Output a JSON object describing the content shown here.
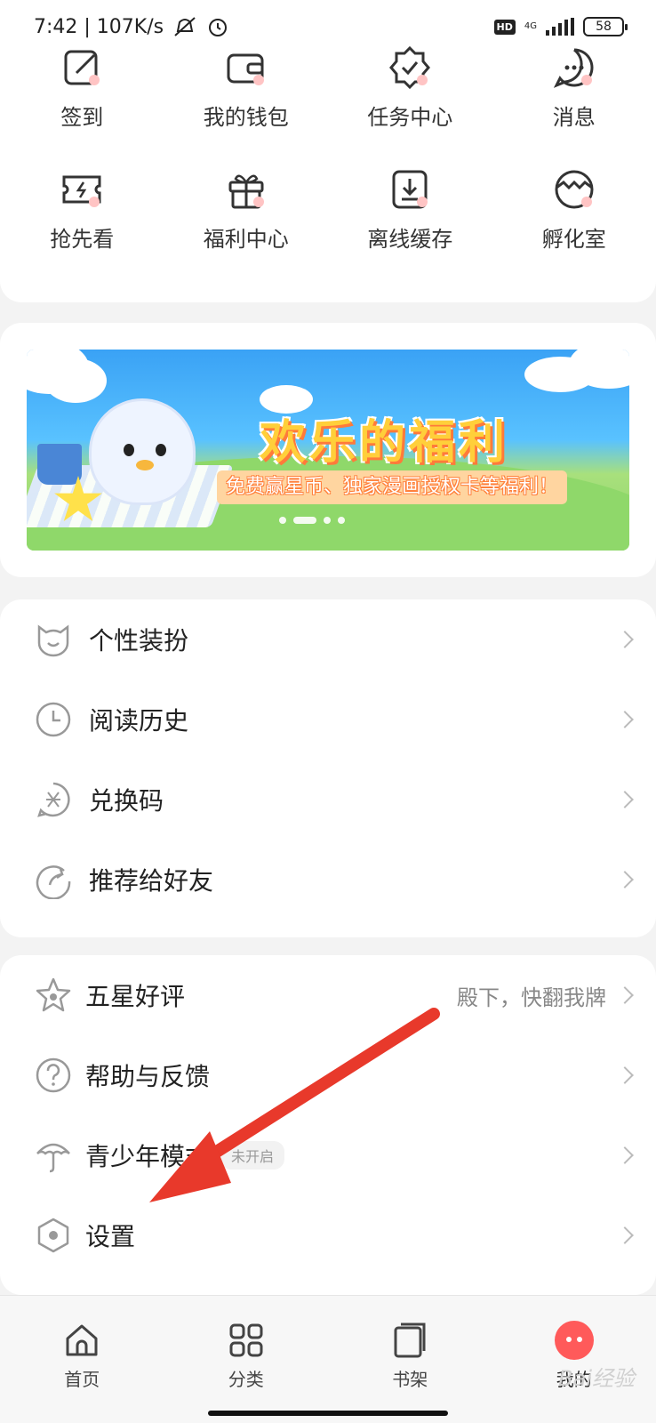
{
  "status_bar": {
    "time": "7:42 | 107K/s",
    "hd": "HD",
    "network": "4G",
    "battery": "58"
  },
  "quick_grid": [
    {
      "label": "签到",
      "icon": "sign-in-icon"
    },
    {
      "label": "我的钱包",
      "icon": "wallet-icon"
    },
    {
      "label": "任务中心",
      "icon": "task-badge-icon"
    },
    {
      "label": "消息",
      "icon": "message-icon"
    },
    {
      "label": "抢先看",
      "icon": "ticket-icon"
    },
    {
      "label": "福利中心",
      "icon": "gift-icon"
    },
    {
      "label": "离线缓存",
      "icon": "download-icon"
    },
    {
      "label": "孵化室",
      "icon": "egg-icon"
    }
  ],
  "banner": {
    "title": "欢乐的福利",
    "subtitle": "免费赢星币、独家漫画授权卡等福利！"
  },
  "list_1": [
    {
      "label": "个性装扮",
      "icon": "cat-face-icon"
    },
    {
      "label": "阅读历史",
      "icon": "clock-icon"
    },
    {
      "label": "兑换码",
      "icon": "redeem-icon"
    },
    {
      "label": "推荐给好友",
      "icon": "share-icon"
    }
  ],
  "list_2": [
    {
      "label": "五星好评",
      "icon": "star-icon",
      "right": "殿下，快翻我牌"
    },
    {
      "label": "帮助与反馈",
      "icon": "help-icon"
    },
    {
      "label": "青少年模式",
      "icon": "umbrella-icon",
      "pill": "未开启"
    },
    {
      "label": "设置",
      "icon": "settings-icon"
    }
  ],
  "bottom_nav": [
    {
      "label": "首页",
      "icon": "home-icon"
    },
    {
      "label": "分类",
      "icon": "grid-icon"
    },
    {
      "label": "书架",
      "icon": "bookshelf-icon"
    },
    {
      "label": "我的",
      "icon": "profile-face-icon"
    }
  ],
  "watermark": "Bai经验",
  "colors": {
    "accent": "#ff5a5a",
    "arrow": "#e8392b"
  }
}
